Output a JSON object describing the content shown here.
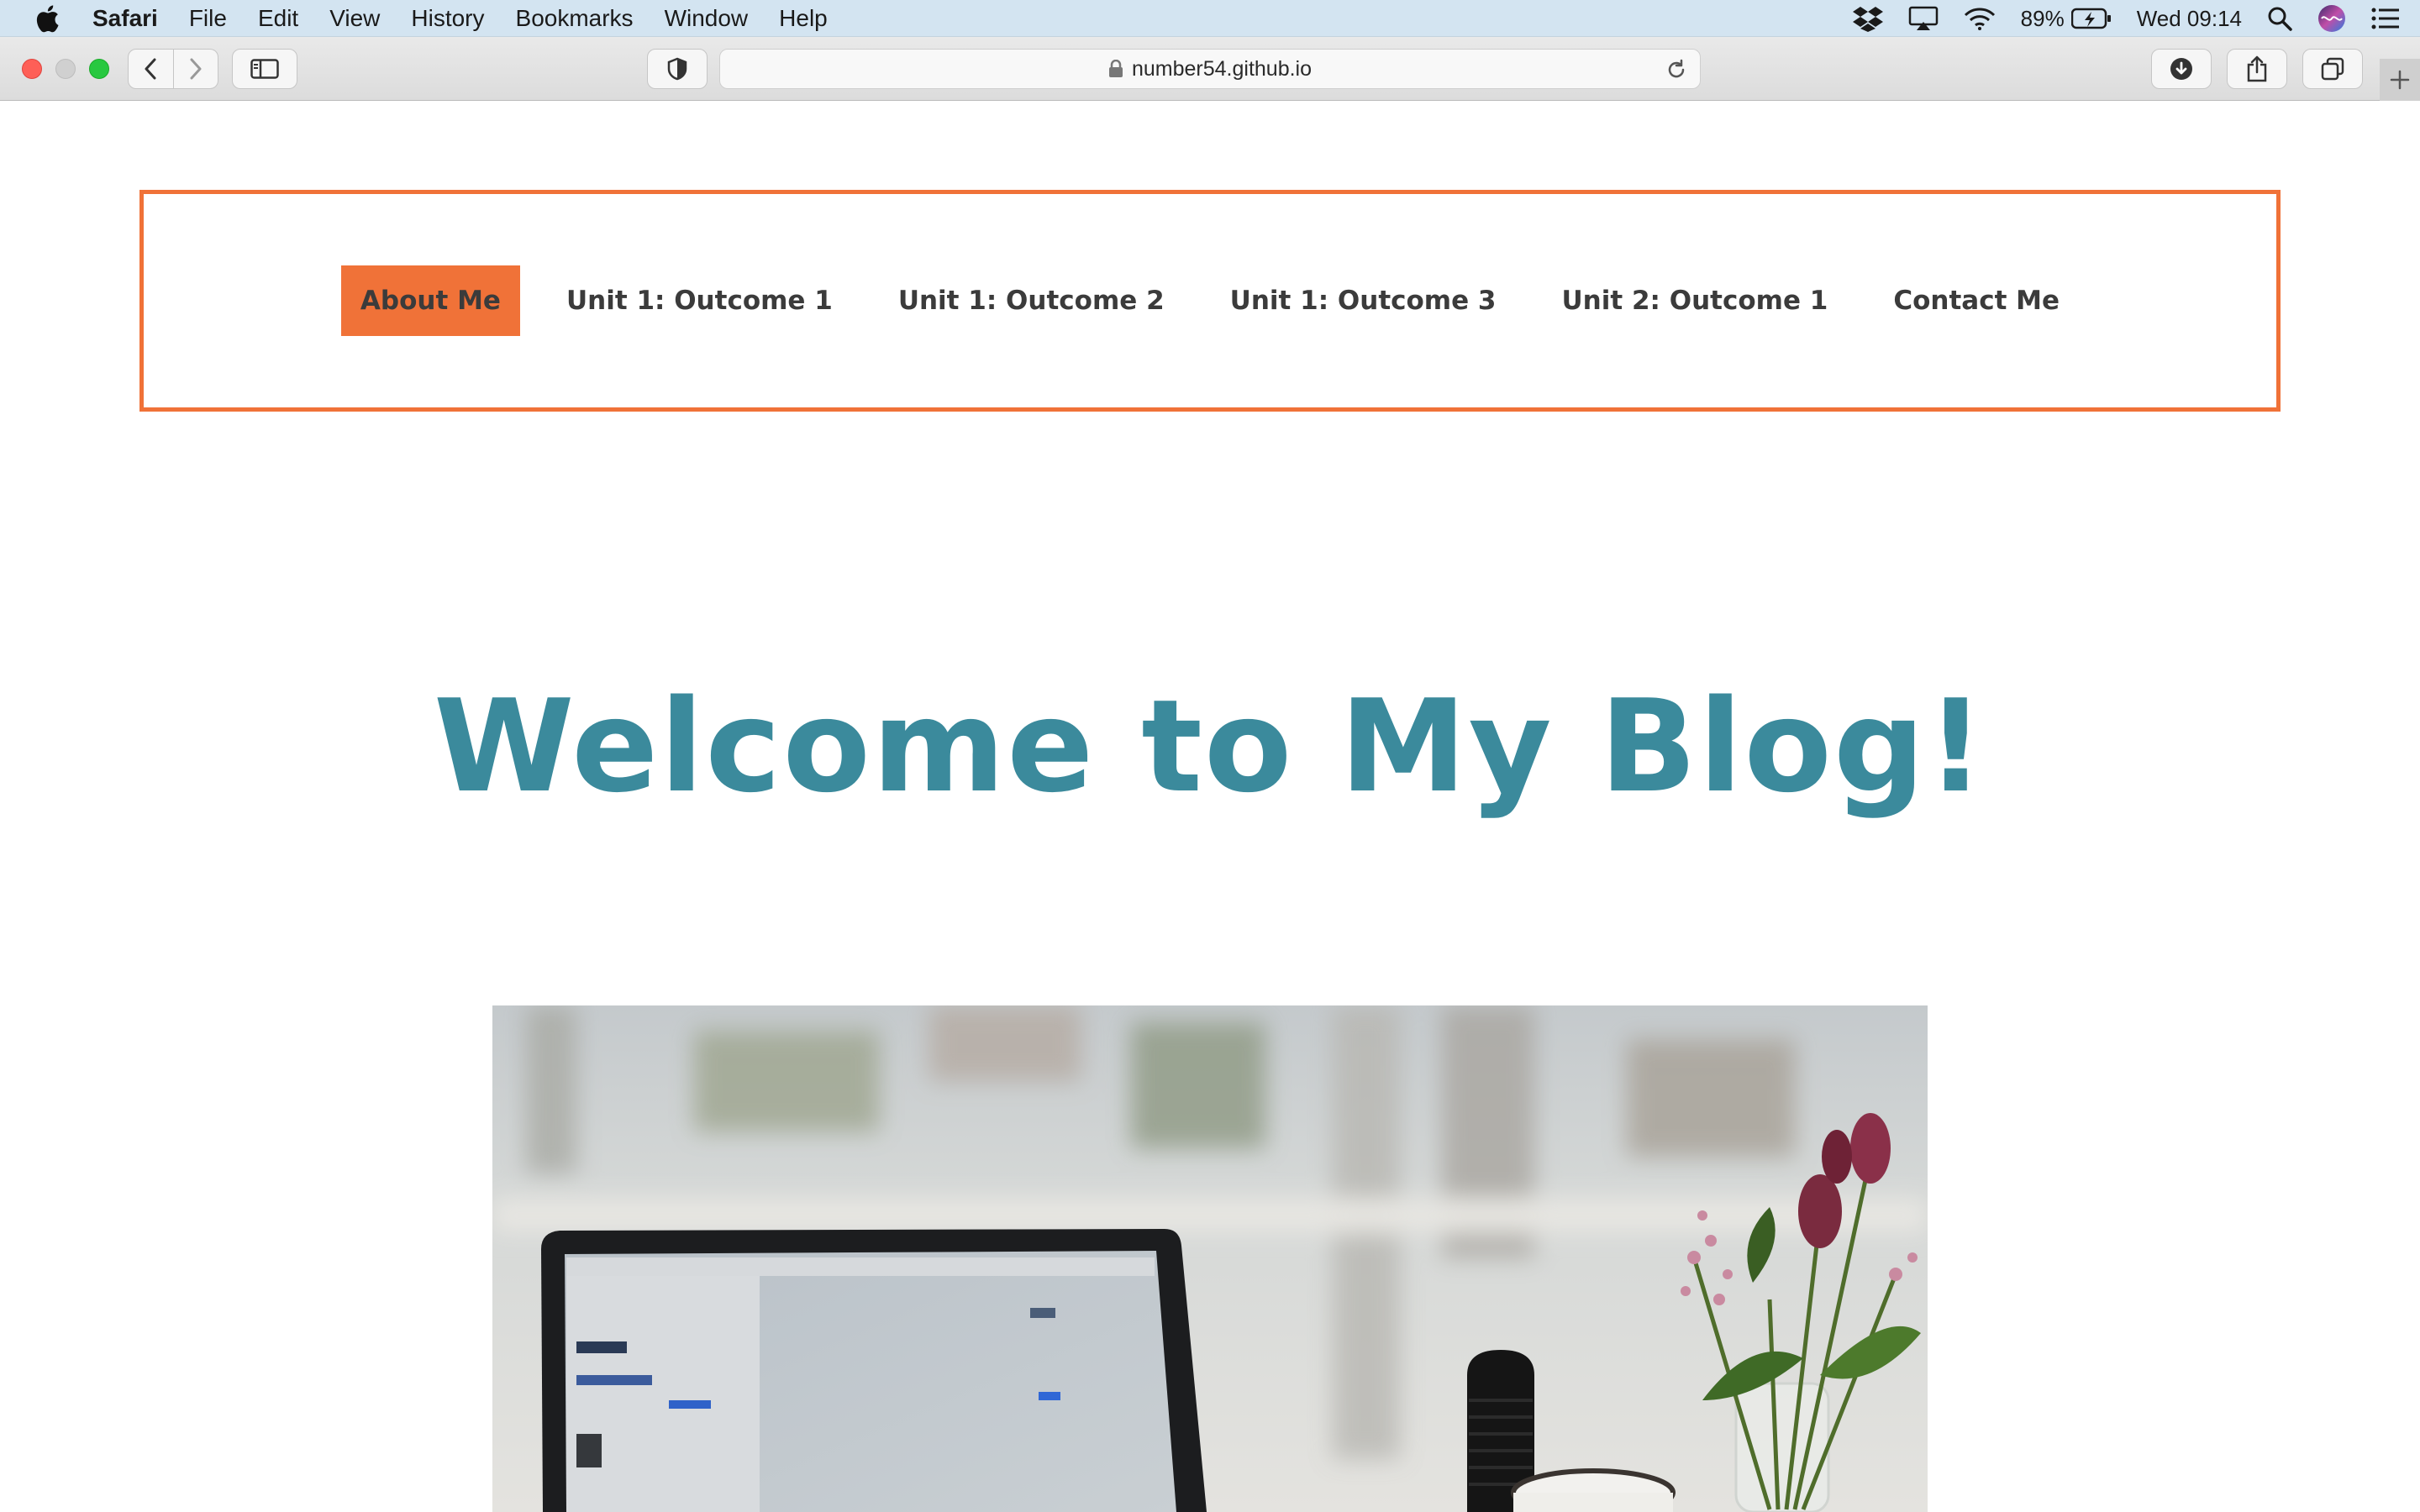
{
  "menubar": {
    "app_name": "Safari",
    "items": [
      "File",
      "Edit",
      "View",
      "History",
      "Bookmarks",
      "Window",
      "Help"
    ],
    "battery": "89%",
    "clock": "Wed 09:14"
  },
  "browser": {
    "url": "number54.github.io"
  },
  "nav": {
    "items": [
      {
        "label": "About Me",
        "active": true
      },
      {
        "label": "Unit 1: Outcome 1",
        "active": false
      },
      {
        "label": "Unit 1: Outcome 2",
        "active": false
      },
      {
        "label": "Unit 1: Outcome 3",
        "active": false
      },
      {
        "label": "Unit 2: Outcome 1",
        "active": false
      },
      {
        "label": "Contact Me",
        "active": false
      }
    ]
  },
  "hero": {
    "title": "Welcome to My Blog!",
    "image": "photo-laptop-coffee-flowers"
  },
  "colors": {
    "accent": "#f07238",
    "title": "#3b8a9c",
    "menubar": "#d3e4f1"
  },
  "icons": [
    "apple-icon",
    "dropbox-icon",
    "airplay-icon",
    "wifi-icon",
    "battery-icon",
    "spotlight-icon",
    "siri-icon",
    "control-center-icon",
    "back-icon",
    "forward-icon",
    "sidebar-icon",
    "shield-icon",
    "lock-icon",
    "reload-icon",
    "download-icon",
    "share-icon",
    "tabs-icon",
    "plus-icon"
  ]
}
